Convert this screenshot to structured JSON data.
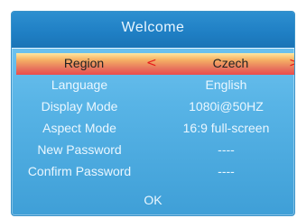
{
  "dialog": {
    "title": "Welcome",
    "rows": [
      {
        "label": "Region",
        "value": "Czech",
        "selected": true,
        "left_arrow": "<",
        "right_arrow": ">"
      },
      {
        "label": "Language",
        "value": "English"
      },
      {
        "label": "Display Mode",
        "value": "1080i@50HZ"
      },
      {
        "label": "Aspect Mode",
        "value": "16:9 full-screen"
      },
      {
        "label": "New Password",
        "value": "----"
      },
      {
        "label": "Confirm Password",
        "value": "----"
      }
    ],
    "ok_label": "OK"
  },
  "colors": {
    "panel": "#58b4e6",
    "title_bar": "#1f7fc4",
    "highlight_top": "#ffe7a0",
    "highlight_bottom": "#ec4b4b",
    "arrow": "#e61919",
    "text": "#eaf7ff"
  },
  "icons": {
    "left_arrow": "chevron-left-icon",
    "right_arrow": "chevron-right-icon"
  }
}
